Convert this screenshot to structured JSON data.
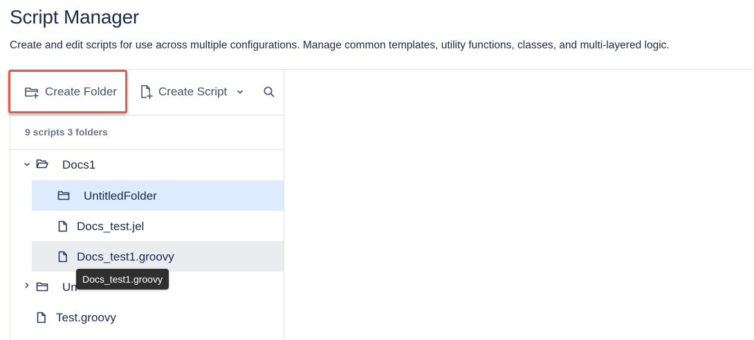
{
  "page": {
    "title": "Script Manager",
    "description": "Create and edit scripts for use across multiple configurations. Manage common templates, utility functions, classes, and multi-layered logic."
  },
  "toolbar": {
    "create_folder_label": "Create Folder",
    "create_folder_icon": "folder-plus-icon",
    "create_script_label": "Create Script",
    "create_script_icon": "file-plus-icon",
    "search_icon": "search-icon",
    "highlight_color": "#e8584b"
  },
  "summary": {
    "text": "9 scripts 3 folders"
  },
  "tree": {
    "items": [
      {
        "label": "Docs1",
        "type": "folder",
        "expanded": true
      },
      {
        "label": "UntitledFolder",
        "type": "folder",
        "selected": true
      },
      {
        "label": "Docs_test.jel",
        "type": "file"
      },
      {
        "label": "Docs_test1.groovy",
        "type": "file",
        "hovered": true
      },
      {
        "label": "Un",
        "type": "folder",
        "expanded": false
      },
      {
        "label": "Test.groovy",
        "type": "file"
      }
    ]
  },
  "tooltip": {
    "text": "Docs_test1.groovy"
  },
  "colors": {
    "selected_row": "#deebff",
    "hover_row": "#ebecf0",
    "text": "#172b4d",
    "muted_text": "#6b778c"
  }
}
